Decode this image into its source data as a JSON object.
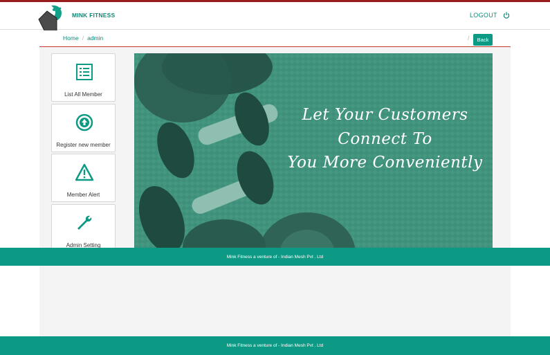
{
  "header": {
    "brand": "MINK FITNESS",
    "logout_label": "LOGOUT"
  },
  "breadcrumb": {
    "home": "Home",
    "separator": "/",
    "current": "admin"
  },
  "back_button": {
    "label": "Back",
    "separator": "/"
  },
  "menu_cards": [
    {
      "label": "List All Member",
      "icon": "list-icon"
    },
    {
      "label": "Register new member",
      "icon": "arrow-up-circle-icon"
    },
    {
      "label": "Member Alert",
      "icon": "warning-triangle-icon"
    },
    {
      "label": "Admin Setting",
      "icon": "wrench-icon"
    }
  ],
  "banner": {
    "line1": "Let Your Customers",
    "line2": "Connect To",
    "line3": "You More Conveniently"
  },
  "footer": {
    "text": "Mink Fitness a venture of - Indian Mesh Pvt . Ltd"
  },
  "colors": {
    "accent": "#0d9a85",
    "top_line": "#9b1c1c",
    "breadcrumb_rule": "#c0392b",
    "banner": "#3e8f7b"
  }
}
